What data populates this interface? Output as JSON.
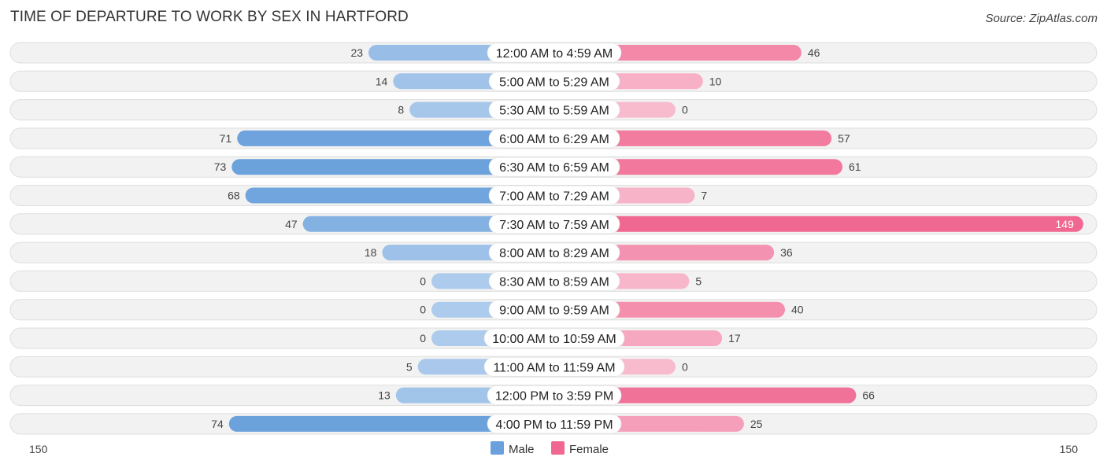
{
  "chart_data": {
    "type": "bar",
    "orientation": "horizontal-diverging",
    "title": "TIME OF DEPARTURE TO WORK BY SEX IN HARTFORD",
    "source": "Source: ZipAtlas.com",
    "categories": [
      "12:00 AM to 4:59 AM",
      "5:00 AM to 5:29 AM",
      "5:30 AM to 5:59 AM",
      "6:00 AM to 6:29 AM",
      "6:30 AM to 6:59 AM",
      "7:00 AM to 7:29 AM",
      "7:30 AM to 7:59 AM",
      "8:00 AM to 8:29 AM",
      "8:30 AM to 8:59 AM",
      "9:00 AM to 9:59 AM",
      "10:00 AM to 10:59 AM",
      "11:00 AM to 11:59 AM",
      "12:00 PM to 3:59 PM",
      "4:00 PM to 11:59 PM"
    ],
    "series": [
      {
        "name": "Male",
        "color": "#6aa1dc",
        "values": [
          23,
          14,
          8,
          71,
          73,
          68,
          47,
          18,
          0,
          0,
          0,
          5,
          13,
          74
        ]
      },
      {
        "name": "Female",
        "color": "#f06892",
        "values": [
          46,
          10,
          0,
          57,
          61,
          7,
          149,
          36,
          5,
          40,
          17,
          0,
          66,
          25
        ]
      }
    ],
    "axis": {
      "left_label": "150",
      "right_label": "150",
      "max": 150
    },
    "legend": {
      "position": "bottom-center",
      "items": [
        "Male",
        "Female"
      ]
    },
    "grid": false
  }
}
